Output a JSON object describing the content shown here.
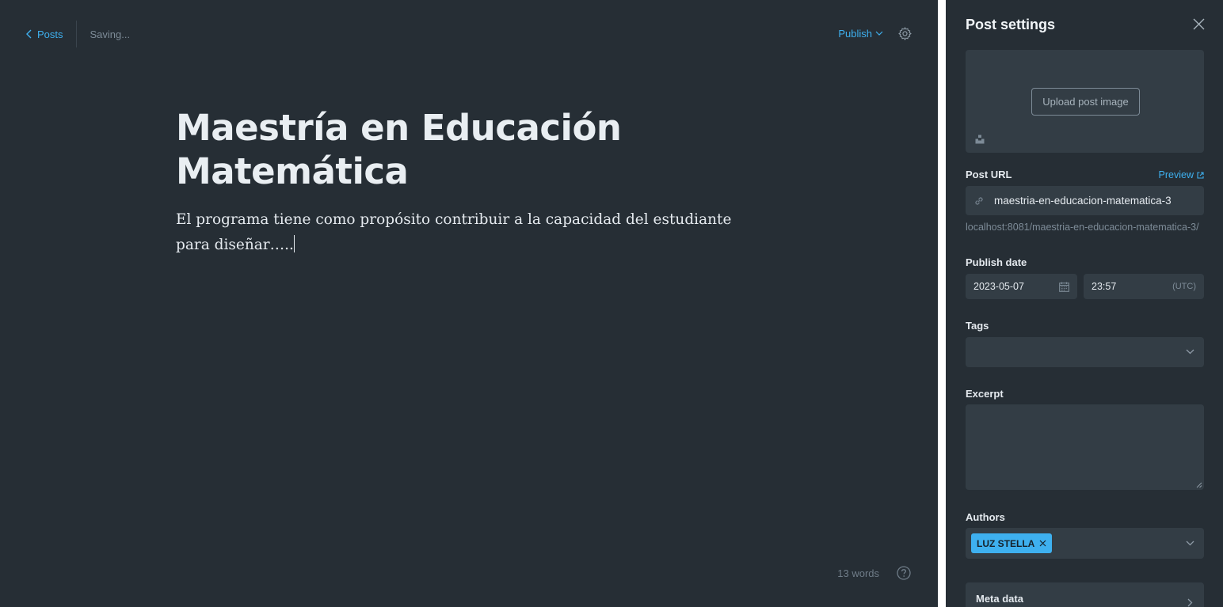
{
  "header": {
    "back_label": "Posts",
    "status": "Saving...",
    "publish_label": "Publish"
  },
  "post": {
    "title": "Maestría en Educación Matemática",
    "body": "El programa tiene como propósito contribuir a la capacidad del estudiante para diseñar….."
  },
  "footer": {
    "word_count": "13 words"
  },
  "settings": {
    "title": "Post settings",
    "upload_label": "Upload post image",
    "post_url_label": "Post URL",
    "preview_label": "Preview",
    "slug": "maestria-en-educacion-matematica-3",
    "full_url": "localhost:8081/maestria-en-educacion-matematica-3/",
    "publish_date_label": "Publish date",
    "date": "2023-05-07",
    "time": "23:57",
    "timezone": "(UTC)",
    "tags_label": "Tags",
    "excerpt_label": "Excerpt",
    "authors_label": "Authors",
    "author_name": "LUZ STELLA",
    "meta_data_label": "Meta data"
  },
  "colors": {
    "background": "#262e35",
    "accent": "#3eb0ef",
    "input_bg": "#333d45",
    "muted_text": "#7d8b97"
  }
}
